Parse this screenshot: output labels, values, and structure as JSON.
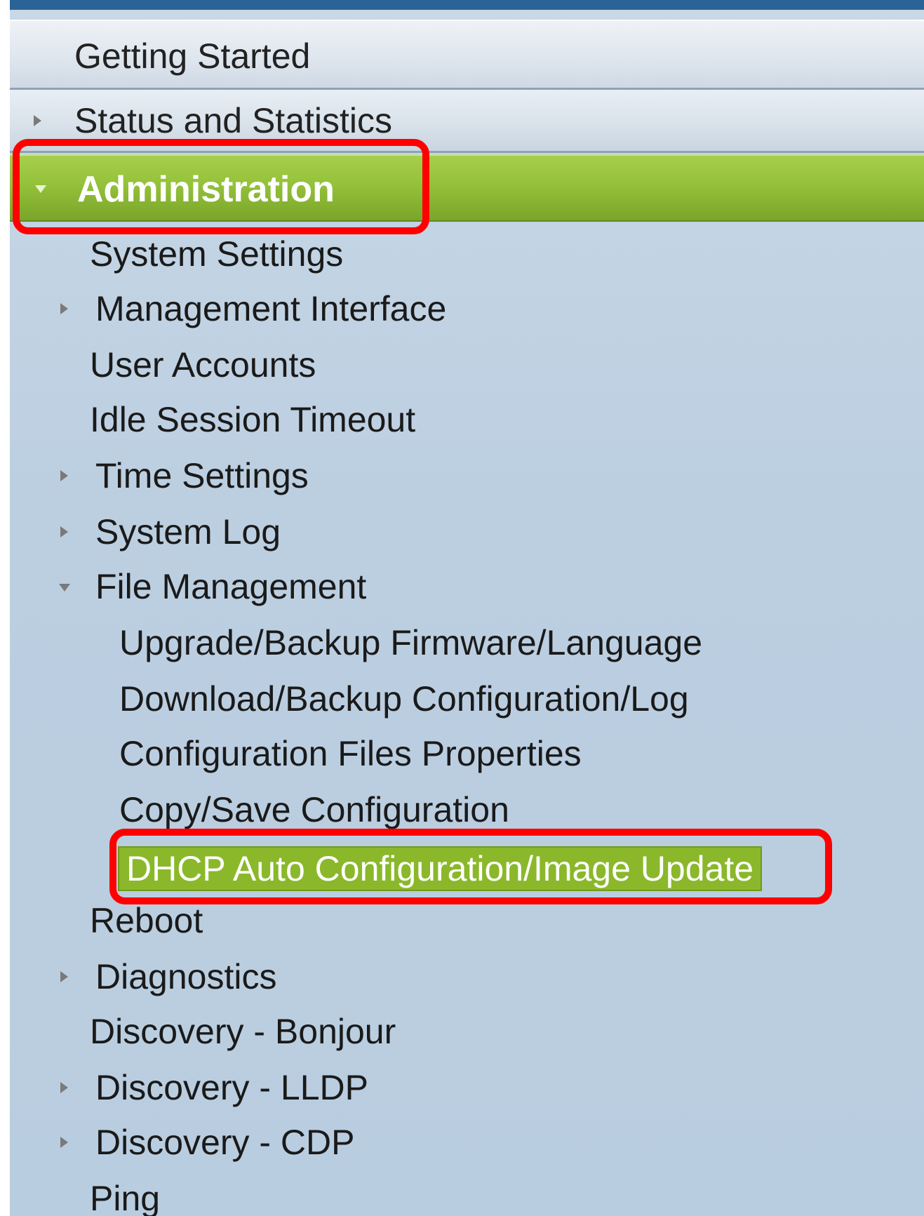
{
  "colors": {
    "window_accent": "#2a6496",
    "nav_background": "#bccfe1",
    "section_selected": "#8ab82a",
    "highlight_outline": "#ff0000"
  },
  "nav": {
    "getting_started": "Getting Started",
    "status_and_statistics": "Status and Statistics",
    "administration": "Administration",
    "items": {
      "system_settings": "System Settings",
      "management_interface": "Management Interface",
      "user_accounts": "User Accounts",
      "idle_session_timeout": "Idle Session Timeout",
      "time_settings": "Time Settings",
      "system_log": "System Log",
      "file_management": "File Management",
      "upgrade_backup_firmware": "Upgrade/Backup Firmware/Language",
      "download_backup_config": "Download/Backup Configuration/Log",
      "config_files_properties": "Configuration Files Properties",
      "copy_save_config": "Copy/Save Configuration",
      "dhcp_auto_config": "DHCP Auto Configuration/Image Update",
      "reboot": "Reboot",
      "diagnostics": "Diagnostics",
      "discovery_bonjour": "Discovery - Bonjour",
      "discovery_lldp": "Discovery - LLDP",
      "discovery_cdp": "Discovery - CDP",
      "ping": "Ping"
    },
    "selected_item": "DHCP Auto Configuration/Image Update"
  }
}
